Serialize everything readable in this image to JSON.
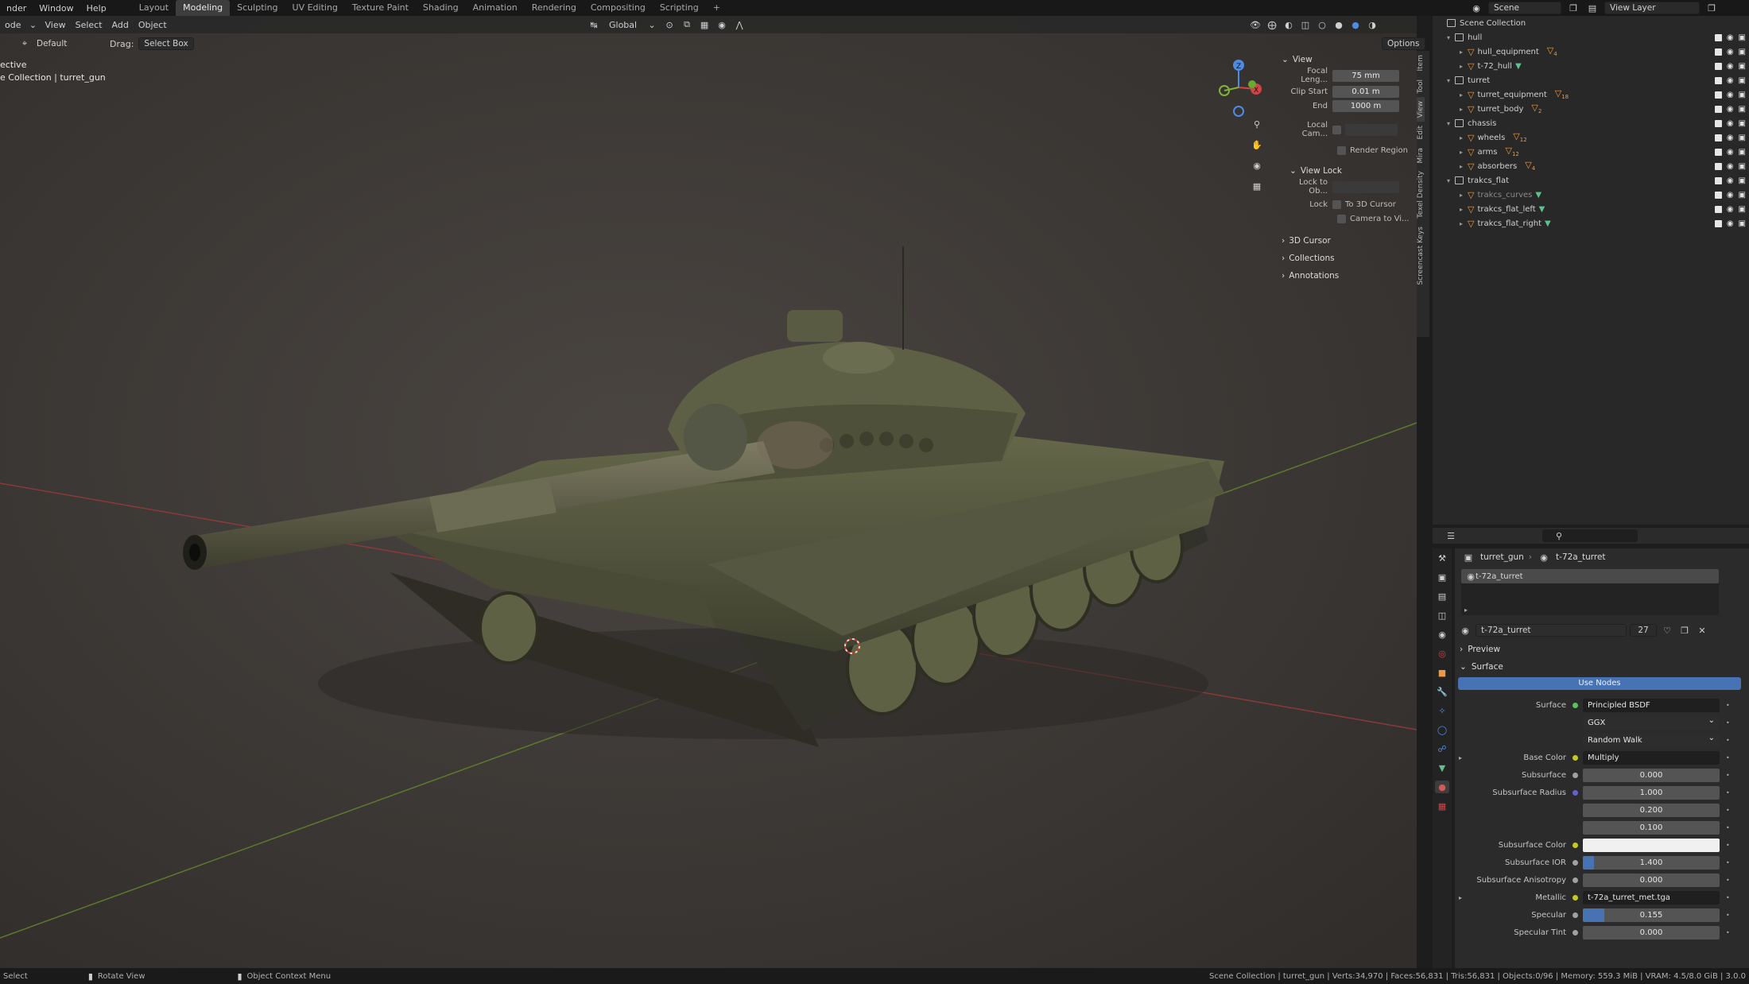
{
  "topbar": {
    "menus": [
      "nder",
      "Window",
      "Help"
    ],
    "workspaces": [
      "Layout",
      "Modeling",
      "Sculpting",
      "UV Editing",
      "Texture Paint",
      "Shading",
      "Animation",
      "Rendering",
      "Compositing",
      "Scripting",
      "+"
    ],
    "active_workspace": "Modeling",
    "scene": "Scene",
    "view_layer": "View Layer"
  },
  "viewport_header": {
    "mode": "ode",
    "menus": [
      "View",
      "Select",
      "Add",
      "Object"
    ],
    "orientation": "Global",
    "options": "Options",
    "transform_label": "Default",
    "drag_label": "Drag:",
    "drag_value": "Select Box"
  },
  "viewport_overlay": {
    "view_name": "ective",
    "collection_path": "e Collection | turret_gun"
  },
  "npanel": {
    "view_header": "View",
    "focal_label": "Focal Leng...",
    "focal_value": "75 mm",
    "clip_start_label": "Clip Start",
    "clip_start_value": "0.01 m",
    "end_label": "End",
    "end_value": "1000 m",
    "local_cam_label": "Local Cam...",
    "render_region": "Render Region",
    "view_lock_header": "View Lock",
    "lock_to_ob_label": "Lock to Ob...",
    "lock_label": "Lock",
    "to_3d_cursor": "To 3D Cursor",
    "camera_to_view": "Camera to Vi...",
    "cursor_3d": "3D Cursor",
    "collections": "Collections",
    "annotations": "Annotations",
    "tabs": [
      "Item",
      "Tool",
      "View",
      "Edit",
      "Mira",
      "Texel Density",
      "Screencast Keys"
    ]
  },
  "outliner": {
    "root": "Scene Collection",
    "items": [
      {
        "name": "hull",
        "kind": "collection"
      },
      {
        "name": "hull_equipment",
        "kind": "object",
        "badge": "4"
      },
      {
        "name": "t-72_hull",
        "kind": "object"
      },
      {
        "name": "turret",
        "kind": "collection"
      },
      {
        "name": "turret_equipment",
        "kind": "object",
        "badge": "18"
      },
      {
        "name": "turret_body",
        "kind": "object",
        "badge": "2"
      },
      {
        "name": "chassis",
        "kind": "collection"
      },
      {
        "name": "wheels",
        "kind": "object",
        "badge": "12"
      },
      {
        "name": "arms",
        "kind": "object",
        "badge": "12"
      },
      {
        "name": "absorbers",
        "kind": "object",
        "badge": "4"
      },
      {
        "name": "trakcs_flat",
        "kind": "collection"
      },
      {
        "name": "trakcs_curves",
        "kind": "object"
      },
      {
        "name": "trakcs_flat_left",
        "kind": "object"
      },
      {
        "name": "trakcs_flat_right",
        "kind": "object"
      }
    ]
  },
  "properties": {
    "breadcrumb_obj": "turret_gun",
    "breadcrumb_mat": "t-72a_turret",
    "slot_name": "t-72a_turret",
    "material_name": "t-72a_turret",
    "user_count": "27",
    "preview": "Preview",
    "surface_header": "Surface",
    "use_nodes": "Use Nodes",
    "rows": [
      {
        "label": "Surface",
        "value": "Principled BSDF",
        "kind": "dark",
        "dot": "#5fbf5f"
      },
      {
        "label": "",
        "value": "GGX",
        "kind": "select"
      },
      {
        "label": "",
        "value": "Random Walk",
        "kind": "select"
      },
      {
        "label": "Base Color",
        "value": "Multiply",
        "kind": "dark",
        "dot": "#c7c729",
        "expand": true
      },
      {
        "label": "Subsurface",
        "value": "0.000",
        "kind": "num",
        "dot": "#a1a1a1",
        "fill": 0
      },
      {
        "label": "Subsurface Radius",
        "value": "1.000",
        "kind": "num",
        "dot": "#6363c7",
        "fill": 0
      },
      {
        "label": "",
        "value": "0.200",
        "kind": "num",
        "fill": 0
      },
      {
        "label": "",
        "value": "0.100",
        "kind": "num",
        "fill": 0
      },
      {
        "label": "Subsurface Color",
        "value": "",
        "kind": "color",
        "dot": "#c7c729"
      },
      {
        "label": "Subsurface IOR",
        "value": "1.400",
        "kind": "num",
        "dot": "#a1a1a1",
        "fill": 0.08
      },
      {
        "label": "Subsurface Anisotropy",
        "value": "0.000",
        "kind": "num",
        "dot": "#a1a1a1",
        "fill": 0
      },
      {
        "label": "Metallic",
        "value": "t-72a_turret_met.tga",
        "kind": "dark",
        "dot": "#c7c729",
        "expand": true
      },
      {
        "label": "Specular",
        "value": "0.155",
        "kind": "num",
        "dot": "#a1a1a1",
        "fill": 0.155
      },
      {
        "label": "Specular Tint",
        "value": "0.000",
        "kind": "num",
        "dot": "#a1a1a1",
        "fill": 0
      }
    ]
  },
  "status": {
    "left1": "Select",
    "left2": "Rotate View",
    "left3": "Object Context Menu",
    "right": "Scene Collection | turret_gun | Verts:34,970 | Faces:56,831 | Tris:56,831 | Objects:0/96 | Memory: 559.3 MiB | VRAM: 4.5/8.0 GiB | 3.0.0"
  }
}
